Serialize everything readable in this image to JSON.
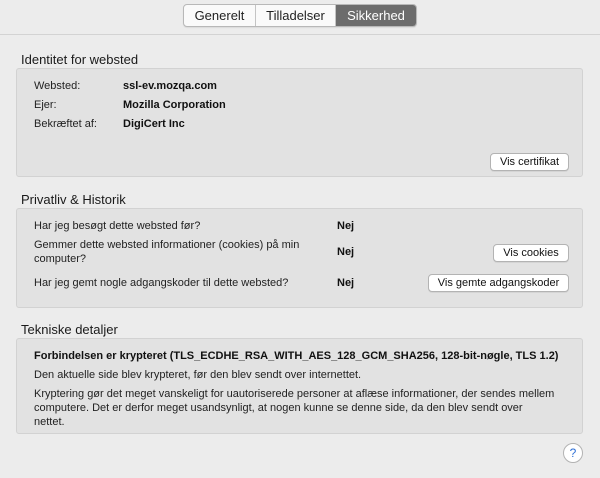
{
  "tabs": [
    {
      "label": "Generelt"
    },
    {
      "label": "Tilladelser"
    },
    {
      "label": "Sikkerhed"
    }
  ],
  "identity": {
    "title": "Identitet for websted",
    "rows": [
      {
        "label": "Websted:",
        "value": "ssl-ev.mozqa.com"
      },
      {
        "label": "Ejer:",
        "value": "Mozilla Corporation"
      },
      {
        "label": "Bekræftet af:",
        "value": "DigiCert Inc"
      }
    ],
    "view_cert_button": "Vis certifikat"
  },
  "privacy": {
    "title": "Privatliv & Historik",
    "visited_question": "Har jeg besøgt dette websted før?",
    "visited_answer": "Nej",
    "cookies_question_line1": "Gemmer dette websted informationer (cookies) på min",
    "cookies_question_line2": "computer?",
    "cookies_answer": "Nej",
    "cookies_button": "Vis cookies",
    "passwords_question": "Har jeg gemt nogle adgangskoder til dette websted?",
    "passwords_answer": "Nej",
    "passwords_button": "Vis gemte adgangskoder"
  },
  "technical": {
    "title": "Tekniske detaljer",
    "headline": "Forbindelsen er krypteret (TLS_ECDHE_RSA_WITH_AES_128_GCM_SHA256, 128-bit-nøgle, TLS 1.2)",
    "line1": "Den aktuelle side blev krypteret, før den blev sendt over internettet.",
    "para_line1": "Kryptering gør det meget vanskeligt for uautoriserede personer at aflæse informationer, der sendes mellem",
    "para_line2": "computere. Det er derfor meget usandsynligt, at nogen kunne se denne side, da den blev sendt over",
    "para_line3": "nettet."
  },
  "help_button": "?"
}
